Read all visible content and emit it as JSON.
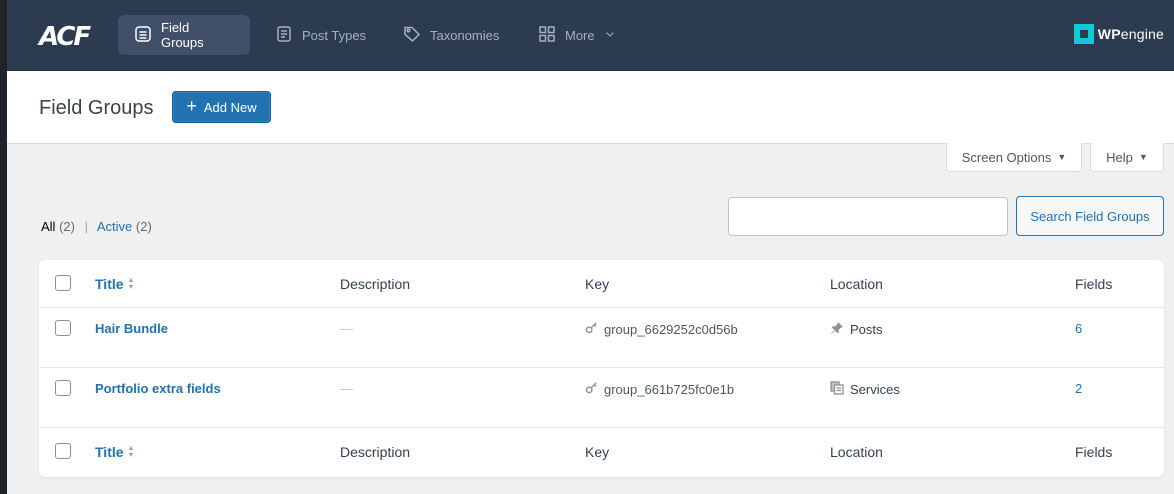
{
  "topnav": {
    "logo": "ACF",
    "tabs": [
      {
        "label": "Field Groups",
        "icon": "list-icon",
        "active": true
      },
      {
        "label": "Post Types",
        "icon": "document-icon",
        "active": false
      },
      {
        "label": "Taxonomies",
        "icon": "tag-icon",
        "active": false
      },
      {
        "label": "More",
        "icon": "grid-icon",
        "active": false
      }
    ],
    "brand_bold": "WP",
    "brand_light": "engine"
  },
  "header": {
    "title": "Field Groups",
    "add_new": "Add New"
  },
  "screen_meta": {
    "screen_options": "Screen Options",
    "help": "Help"
  },
  "filters": {
    "all_label": "All",
    "all_count": "(2)",
    "active_label": "Active",
    "active_count": "(2)"
  },
  "search": {
    "value": "",
    "button": "Search Field Groups"
  },
  "table": {
    "columns": [
      "Title",
      "Description",
      "Key",
      "Location",
      "Fields"
    ],
    "rows": [
      {
        "title": "Hair Bundle",
        "description": "—",
        "key": "group_6629252c0d56b",
        "location": "Posts",
        "location_icon": "pin-icon",
        "fields": "6"
      },
      {
        "title": "Portfolio extra fields",
        "description": "—",
        "key": "group_661b725fc0e1b",
        "location": "Services",
        "location_icon": "pages-icon",
        "fields": "2"
      }
    ]
  },
  "colors": {
    "topbar": "#2c3b50",
    "accent": "#2271b1",
    "brand": "#0ecad4"
  }
}
